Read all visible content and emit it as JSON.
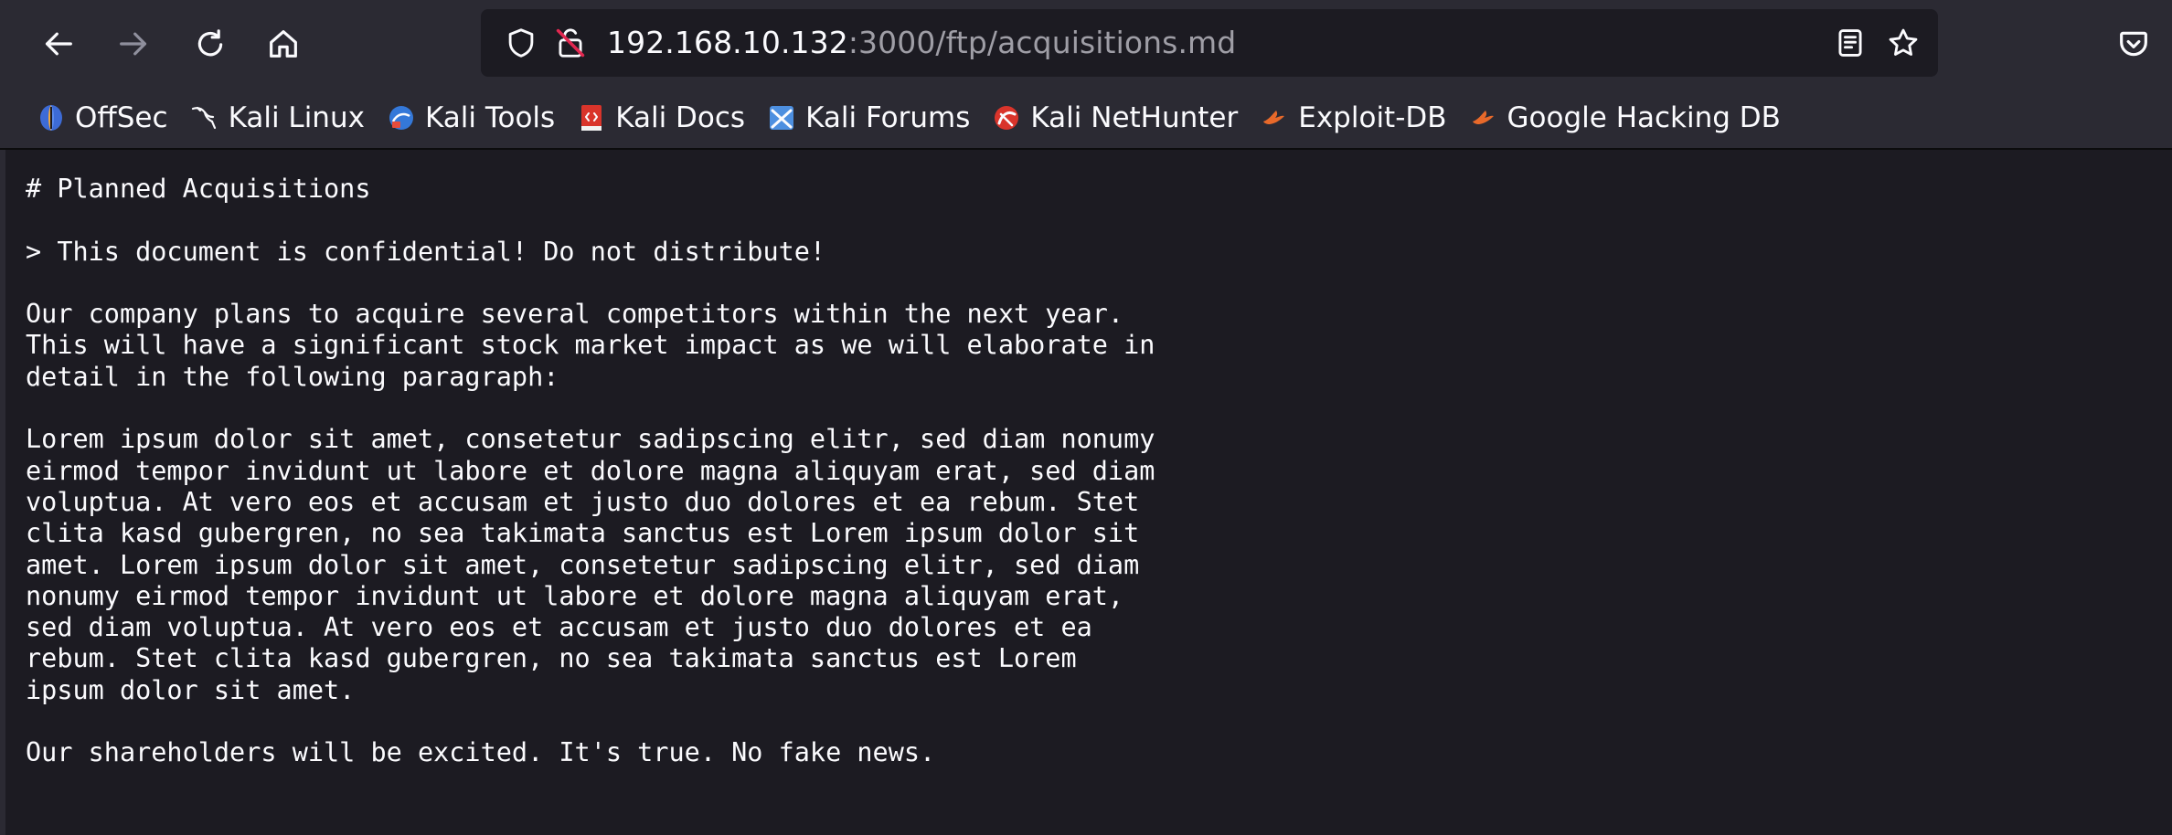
{
  "window": {
    "url_host": "192.168.10.132",
    "url_rest": ":3000/ftp/acquisitions.md"
  },
  "toolbar": {
    "back_icon": "arrow-left-icon",
    "forward_icon": "arrow-right-icon",
    "reload_icon": "reload-icon",
    "home_icon": "home-icon",
    "shield_icon": "tracking-shield-icon",
    "insecure_icon": "insecure-lock-icon",
    "reader_icon": "reader-view-icon",
    "bookmark_icon": "star-icon",
    "pocket_icon": "pocket-icon"
  },
  "bookmarks": [
    {
      "label": "OffSec",
      "icon": "offsec-icon"
    },
    {
      "label": "Kali Linux",
      "icon": "kali-dragon-icon"
    },
    {
      "label": "Kali Tools",
      "icon": "kali-tools-icon"
    },
    {
      "label": "Kali Docs",
      "icon": "kali-docs-icon"
    },
    {
      "label": "Kali Forums",
      "icon": "kali-forums-icon"
    },
    {
      "label": "Kali NetHunter",
      "icon": "kali-nethunter-icon"
    },
    {
      "label": "Exploit-DB",
      "icon": "exploit-db-icon"
    },
    {
      "label": "Google Hacking DB",
      "icon": "google-hacking-db-icon"
    }
  ],
  "document": {
    "lines": [
      "# Planned Acquisitions",
      "",
      "> This document is confidential! Do not distribute!",
      "",
      "Our company plans to acquire several competitors within the next year.",
      "This will have a significant stock market impact as we will elaborate in",
      "detail in the following paragraph:",
      "",
      "Lorem ipsum dolor sit amet, consetetur sadipscing elitr, sed diam nonumy",
      "eirmod tempor invidunt ut labore et dolore magna aliquyam erat, sed diam",
      "voluptua. At vero eos et accusam et justo duo dolores et ea rebum. Stet",
      "clita kasd gubergren, no sea takimata sanctus est Lorem ipsum dolor sit",
      "amet. Lorem ipsum dolor sit amet, consetetur sadipscing elitr, sed diam",
      "nonumy eirmod tempor invidunt ut labore et dolore magna aliquyam erat,",
      "sed diam voluptua. At vero eos et accusam et justo duo dolores et ea",
      "rebum. Stet clita kasd gubergren, no sea takimata sanctus est Lorem",
      "ipsum dolor sit amet.",
      "",
      "Our shareholders will be excited. It's true. No fake news."
    ]
  },
  "colors": {
    "toolbar_bg": "#2b2a33",
    "page_bg": "#1c1b22",
    "text": "#fbfbfe",
    "url_dim": "#9f9ea6",
    "insecure_red": "#e22850"
  }
}
